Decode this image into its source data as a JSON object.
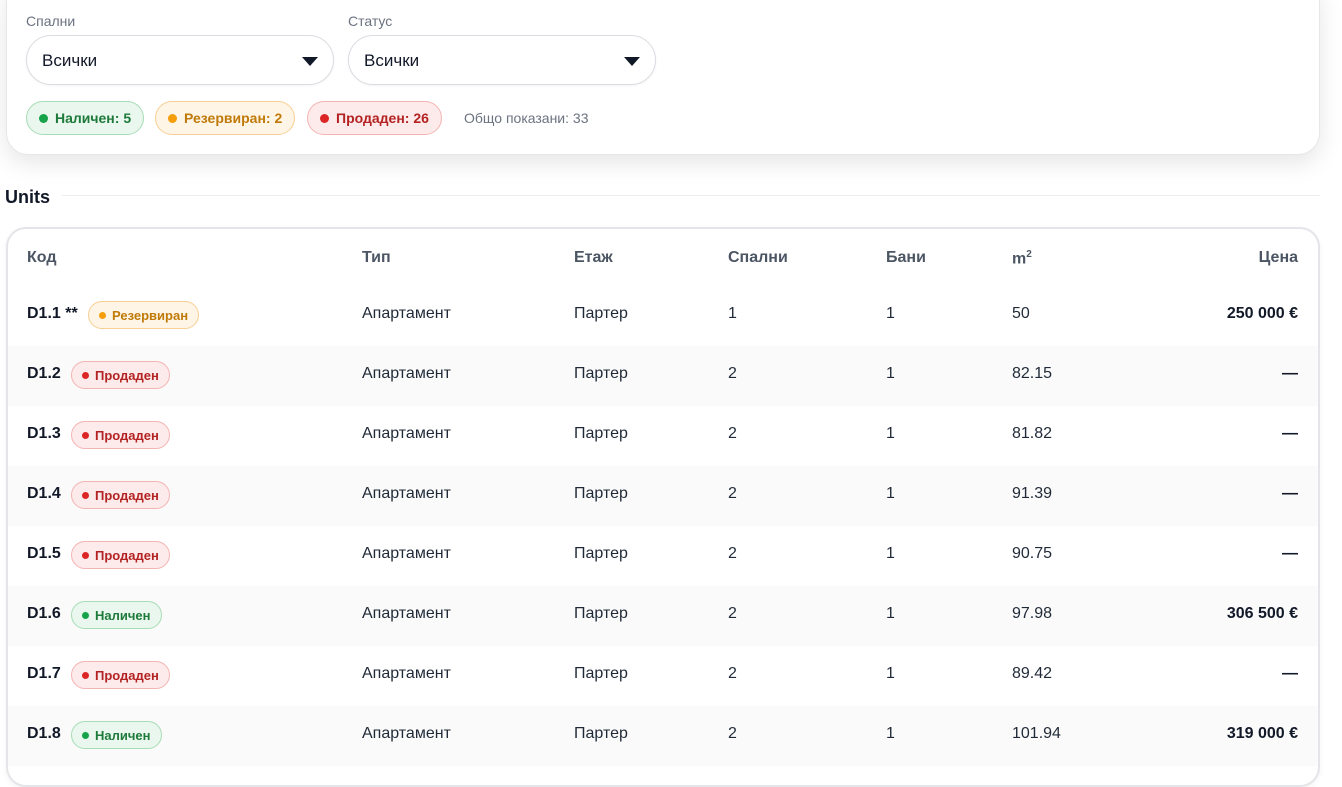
{
  "filters": {
    "bedrooms_label": "Спални",
    "bedrooms_value": "Всички",
    "status_label": "Статус",
    "status_value": "Всички",
    "pills": [
      {
        "text": "Наличен: 5",
        "variant": "green"
      },
      {
        "text": "Резервиран: 2",
        "variant": "orange"
      },
      {
        "text": "Продаден: 26",
        "variant": "red"
      }
    ],
    "total_text": "Общо показани: 33"
  },
  "units": {
    "title": "Units",
    "headers": {
      "code": "Код",
      "type": "Тип",
      "floor": "Етаж",
      "bedrooms": "Спални",
      "baths": "Бани",
      "area": "m",
      "area_sup": "2",
      "price": "Цена"
    },
    "rows": [
      {
        "code": "D1.1 **",
        "status": "Резервиран",
        "variant": "orange",
        "type": "Апартамент",
        "floor": "Партер",
        "bedrooms": "1",
        "baths": "1",
        "area": "50",
        "price": "250 000 €"
      },
      {
        "code": "D1.2",
        "status": "Продаден",
        "variant": "red",
        "type": "Апартамент",
        "floor": "Партер",
        "bedrooms": "2",
        "baths": "1",
        "area": "82.15",
        "price": "—"
      },
      {
        "code": "D1.3",
        "status": "Продаден",
        "variant": "red",
        "type": "Апартамент",
        "floor": "Партер",
        "bedrooms": "2",
        "baths": "1",
        "area": "81.82",
        "price": "—"
      },
      {
        "code": "D1.4",
        "status": "Продаден",
        "variant": "red",
        "type": "Апартамент",
        "floor": "Партер",
        "bedrooms": "2",
        "baths": "1",
        "area": "91.39",
        "price": "—"
      },
      {
        "code": "D1.5",
        "status": "Продаден",
        "variant": "red",
        "type": "Апартамент",
        "floor": "Партер",
        "bedrooms": "2",
        "baths": "1",
        "area": "90.75",
        "price": "—"
      },
      {
        "code": "D1.6",
        "status": "Наличен",
        "variant": "green",
        "type": "Апартамент",
        "floor": "Партер",
        "bedrooms": "2",
        "baths": "1",
        "area": "97.98",
        "price": "306 500 €"
      },
      {
        "code": "D1.7",
        "status": "Продаден",
        "variant": "red",
        "type": "Апартамент",
        "floor": "Партер",
        "bedrooms": "2",
        "baths": "1",
        "area": "89.42",
        "price": "—"
      },
      {
        "code": "D1.8",
        "status": "Наличен",
        "variant": "green",
        "type": "Апартамент",
        "floor": "Партер",
        "bedrooms": "2",
        "baths": "1",
        "area": "101.94",
        "price": "319 000 €"
      }
    ]
  }
}
